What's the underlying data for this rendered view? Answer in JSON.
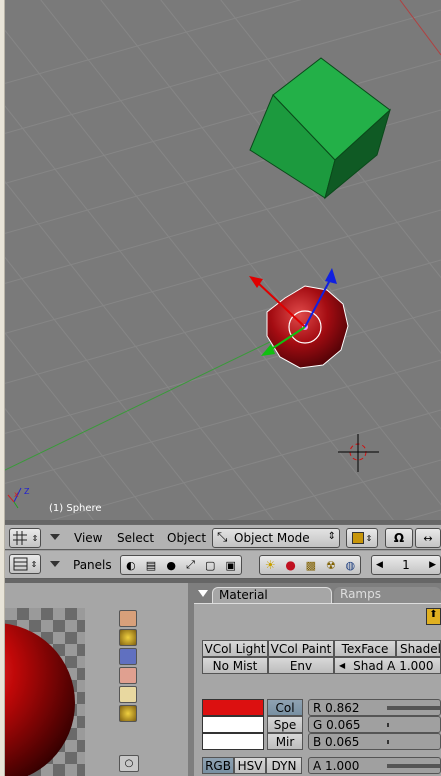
{
  "viewport": {
    "object_label": "(1) Sphere"
  },
  "header1": {
    "menus": [
      "View",
      "Select",
      "Object"
    ],
    "mode_label": "Object Mode"
  },
  "header2": {
    "panels_label": "Panels",
    "frame_value": "1"
  },
  "material": {
    "tabs": [
      "Material",
      "Ramps"
    ],
    "rows": [
      [
        "VCol Light",
        "VCol Paint",
        "TexFace",
        "Shadele"
      ],
      [
        "No Mist",
        "Env",
        "Shad A 1.000"
      ]
    ],
    "color_buttons": [
      "Col",
      "Spe",
      "Mir"
    ],
    "sliders": [
      {
        "label": "R 0.862",
        "value": 0.862
      },
      {
        "label": "G 0.065",
        "value": 0.065
      },
      {
        "label": "B 0.065",
        "value": 0.065
      }
    ],
    "mode_buttons": [
      "RGB",
      "HSV",
      "DYN"
    ],
    "alpha_label": "A 1.000",
    "swatch_colors": [
      "#dc1010",
      "#ffffff",
      "#ffffff"
    ]
  },
  "colors": {
    "cube": "#1c9a3e",
    "sphere": "#b80e16",
    "viewport_bg": "#7a7a7a"
  }
}
